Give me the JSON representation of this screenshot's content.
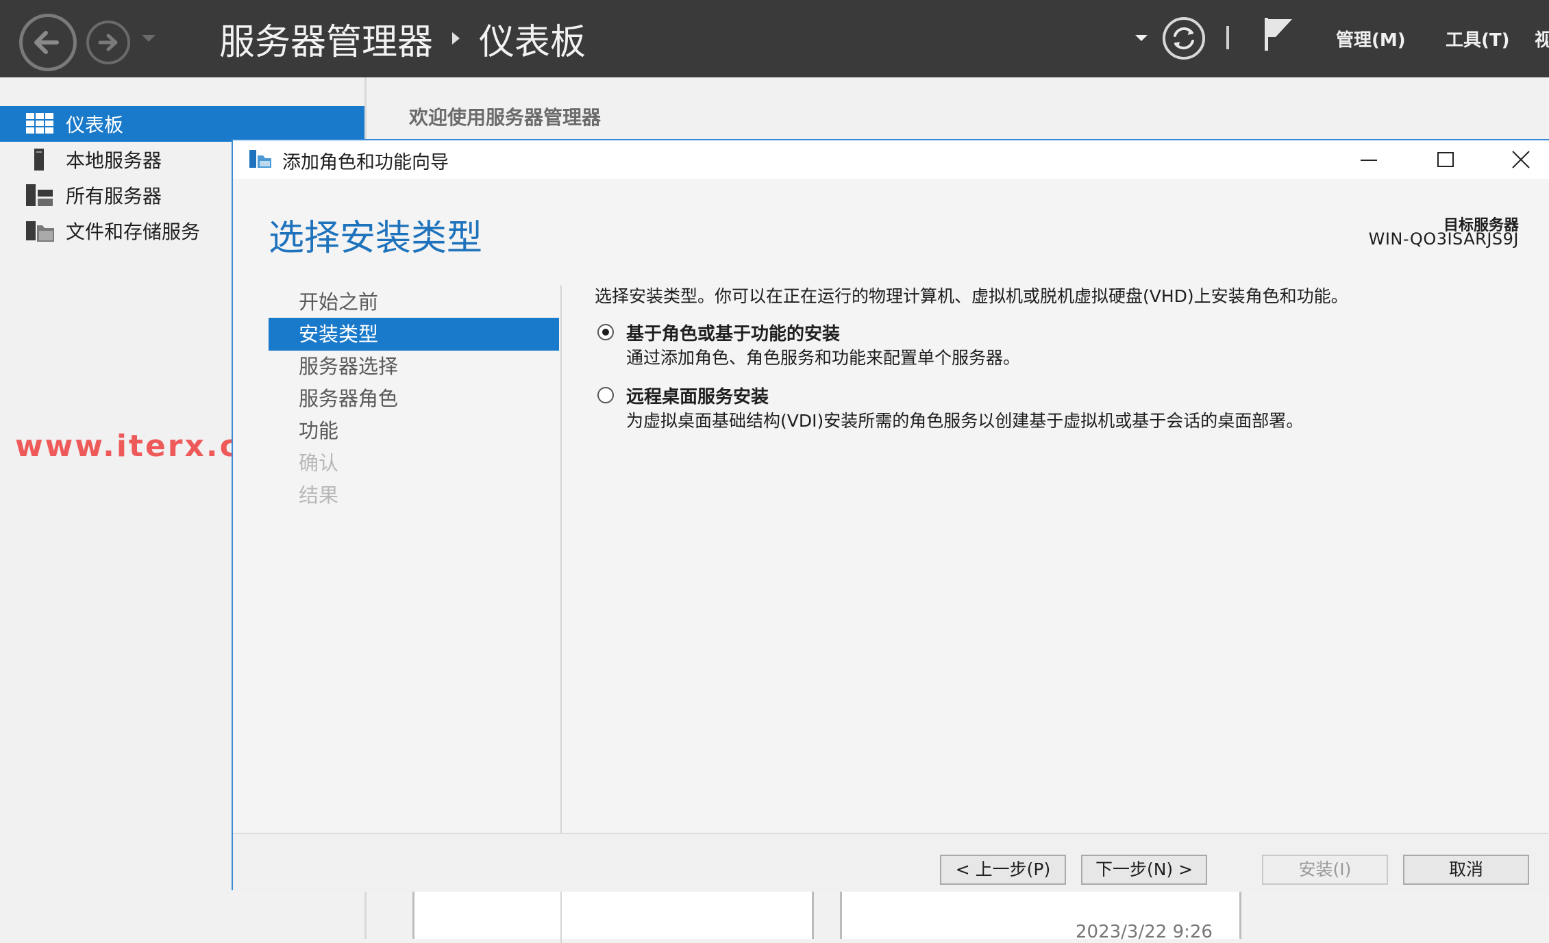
{
  "topbar": {
    "breadcrumb_app": "服务器管理器",
    "breadcrumb_page": "仪表板",
    "menu_manage": "管理(M)",
    "menu_tools": "工具(T)",
    "menu_view_partial": "视"
  },
  "leftnav": {
    "items": [
      {
        "label": "仪表板"
      },
      {
        "label": "本地服务器"
      },
      {
        "label": "所有服务器"
      },
      {
        "label": "文件和存储服务"
      }
    ]
  },
  "main": {
    "welcome": "欢迎使用服务器管理器",
    "timestamp_partial": "2023/3/22 9:26"
  },
  "watermark": "www.iterx.cn",
  "wizard": {
    "title": "添加角色和功能向导",
    "heading": "选择安装类型",
    "target_label": "目标服务器",
    "target_value": "WIN-QO3ISARJS9J",
    "steps": [
      {
        "label": "开始之前"
      },
      {
        "label": "安装类型"
      },
      {
        "label": "服务器选择"
      },
      {
        "label": "服务器角色"
      },
      {
        "label": "功能"
      },
      {
        "label": "确认"
      },
      {
        "label": "结果"
      }
    ],
    "description": "选择安装类型。你可以在正在运行的物理计算机、虚拟机或脱机虚拟硬盘(VHD)上安装角色和功能。",
    "options": [
      {
        "title": "基于角色或基于功能的安装",
        "desc": "通过添加角色、角色服务和功能来配置单个服务器。",
        "selected": true
      },
      {
        "title": "远程桌面服务安装",
        "desc": "为虚拟桌面基础结构(VDI)安装所需的角色服务以创建基于虚拟机或基于会话的桌面部署。",
        "selected": false
      }
    ],
    "buttons": {
      "previous": "< 上一步(P)",
      "next": "下一步(N) >",
      "install": "安装(I)",
      "cancel": "取消"
    }
  }
}
